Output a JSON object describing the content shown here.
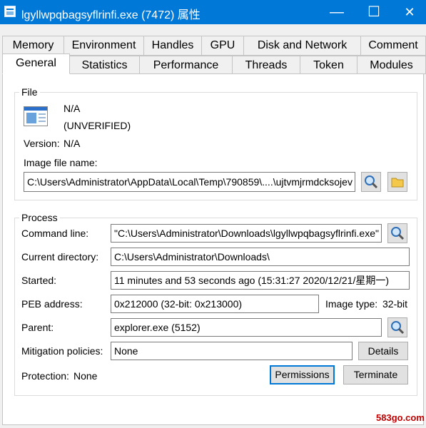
{
  "window": {
    "title": "lgyllwpqbagsyflrinfi.exe (7472) 属性",
    "minimize": "—",
    "maximize": "☐",
    "close": "✕"
  },
  "tabs_row1": [
    "Memory",
    "Environment",
    "Handles",
    "GPU",
    "Disk and Network",
    "Comment"
  ],
  "tabs_row2": [
    "General",
    "Statistics",
    "Performance",
    "Threads",
    "Token",
    "Modules"
  ],
  "active_tab": "General",
  "file": {
    "legend": "File",
    "icon": "executable-file-icon",
    "description": "N/A",
    "company": "(UNVERIFIED)",
    "version_label": "Version:",
    "version": "N/A",
    "image_label": "Image file name:",
    "image_path": "C:\\Users\\Administrator\\AppData\\Local\\Temp\\790859\\....\\ujtvmjrmdcksojev"
  },
  "process": {
    "legend": "Process",
    "command_line_label": "Command line:",
    "command_line": "\"C:\\Users\\Administrator\\Downloads\\lgyllwpqbagsyflrinfi.exe\"",
    "current_dir_label": "Current directory:",
    "current_dir": "C:\\Users\\Administrator\\Downloads\\",
    "started_label": "Started:",
    "started": "11 minutes and 53 seconds ago (15:31:27 2020/12/21/星期一)",
    "peb_label": "PEB address:",
    "peb": "0x212000 (32-bit: 0x213000)",
    "image_type_label": "Image type:",
    "image_type": "32-bit",
    "parent_label": "Parent:",
    "parent": "explorer.exe (5152)",
    "mitigation_label": "Mitigation policies:",
    "mitigation": "None",
    "details_button": "Details",
    "protection_label": "Protection:",
    "protection": "None",
    "permissions_button": "Permissions",
    "terminate_button": "Terminate"
  },
  "watermark": "583go.com",
  "colors": {
    "titlebar": "#0078d7",
    "default_button_border": "#0078d7"
  }
}
